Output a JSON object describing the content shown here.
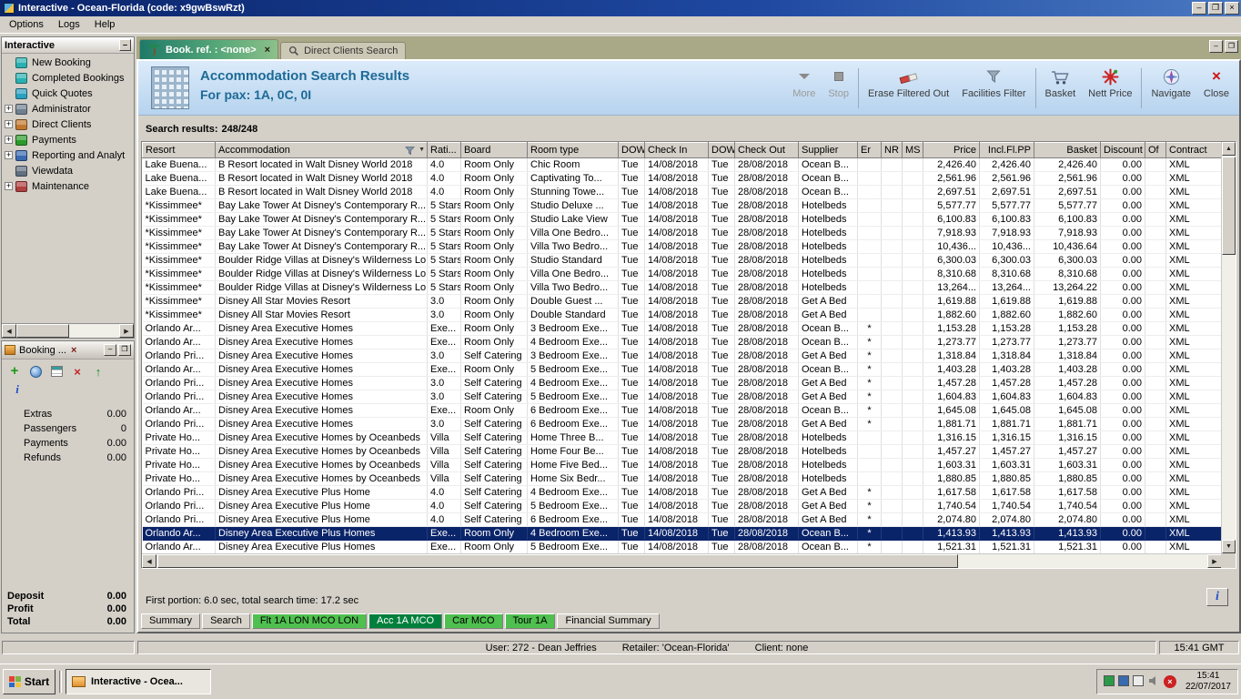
{
  "window": {
    "title": "Interactive - Ocean-Florida (code: x9gwBswRzt)",
    "menu": [
      "Options",
      "Logs",
      "Help"
    ]
  },
  "sidebar": {
    "title": "Interactive",
    "items": [
      {
        "label": "New Booking",
        "expandable": false,
        "icon": "new-booking-icon",
        "icon_color": "#2ab0b0"
      },
      {
        "label": "Completed Bookings",
        "expandable": false,
        "icon": "completed-bookings-icon",
        "icon_color": "#2ab0b0"
      },
      {
        "label": "Quick Quotes",
        "expandable": false,
        "icon": "quick-quotes-icon",
        "icon_color": "#2aa0c0"
      },
      {
        "label": "Administrator",
        "expandable": true,
        "icon": "administrator-icon",
        "icon_color": "#708090"
      },
      {
        "label": "Direct Clients",
        "expandable": true,
        "icon": "direct-clients-icon",
        "icon_color": "#c07830"
      },
      {
        "label": "Payments",
        "expandable": true,
        "icon": "payments-icon",
        "icon_color": "#2a9a2a"
      },
      {
        "label": "Reporting and Analyt",
        "expandable": true,
        "icon": "reporting-icon",
        "icon_color": "#3a6ab0"
      },
      {
        "label": "Viewdata",
        "expandable": false,
        "icon": "viewdata-icon",
        "icon_color": "#607080"
      },
      {
        "label": "Maintenance",
        "expandable": true,
        "icon": "maintenance-icon",
        "icon_color": "#b04040"
      }
    ]
  },
  "booking_panel": {
    "title": "Booking ...",
    "tools": [
      "add-icon",
      "world-icon",
      "quotes-icon",
      "delete-icon",
      "send-icon"
    ],
    "fields": [
      {
        "label": "Extras",
        "value": "0.00"
      },
      {
        "label": "Passengers",
        "value": "0"
      },
      {
        "label": "Payments",
        "value": "0.00"
      },
      {
        "label": "Refunds",
        "value": "0.00"
      }
    ],
    "totals": [
      {
        "label": "Deposit",
        "value": "0.00"
      },
      {
        "label": "Profit",
        "value": "0.00"
      },
      {
        "label": "Total",
        "value": "0.00"
      }
    ]
  },
  "tabs": [
    {
      "label": "Book. ref. : <none>",
      "icon": "palm-tree-icon",
      "active": true,
      "closable": true
    },
    {
      "label": "Direct Clients Search",
      "icon": "search-icon",
      "active": false,
      "closable": false
    }
  ],
  "header": {
    "title_line1": "Accommodation Search Results",
    "title_line2": "For pax: 1A, 0C, 0I",
    "accent_color": "#1d6a96",
    "buttons": [
      {
        "label": "More",
        "icon": "more-icon",
        "disabled": true,
        "sep_after": false
      },
      {
        "label": "Stop",
        "icon": "stop-icon",
        "disabled": true,
        "sep_after": true
      },
      {
        "label": "Erase Filtered Out",
        "icon": "erase-icon",
        "disabled": false,
        "sep_after": false
      },
      {
        "label": "Facilities Filter",
        "icon": "filter-icon",
        "disabled": false,
        "sep_after": true
      },
      {
        "label": "Basket",
        "icon": "basket-icon",
        "disabled": false,
        "sep_after": false
      },
      {
        "label": "Nett Price",
        "icon": "nett-price-icon",
        "disabled": false,
        "sep_after": true
      },
      {
        "label": "Navigate",
        "icon": "navigate-icon",
        "disabled": false,
        "sep_after": false
      },
      {
        "label": "Close",
        "icon": "close-icon",
        "disabled": false,
        "sep_after": false
      }
    ]
  },
  "results": {
    "label": "Search results:",
    "count": "248/248"
  },
  "table": {
    "selected_row": 27,
    "selected_color": "#0a246a",
    "columns": [
      "Resort",
      "Accommodation",
      "Rati...",
      "Board",
      "Room type",
      "DOW",
      "Check In",
      "DOW",
      "Check Out",
      "Supplier",
      "Er",
      "NR",
      "MS",
      "Price",
      "Incl.Fl.PP",
      "Basket",
      "Discount",
      "Of",
      "Contract"
    ],
    "rows": [
      [
        "Lake Buena...",
        "B Resort located in Walt Disney World 2018",
        "4.0",
        "Room Only",
        "Chic Room",
        "Tue",
        "14/08/2018",
        "Tue",
        "28/08/2018",
        "Ocean B...",
        "",
        "",
        "",
        "2,426.40",
        "2,426.40",
        "2,426.40",
        "0.00",
        "",
        "XML"
      ],
      [
        "Lake Buena...",
        "B Resort located in Walt Disney World 2018",
        "4.0",
        "Room Only",
        "Captivating To...",
        "Tue",
        "14/08/2018",
        "Tue",
        "28/08/2018",
        "Ocean B...",
        "",
        "",
        "",
        "2,561.96",
        "2,561.96",
        "2,561.96",
        "0.00",
        "",
        "XML"
      ],
      [
        "Lake Buena...",
        "B Resort located in Walt Disney World 2018",
        "4.0",
        "Room Only",
        "Stunning Towe...",
        "Tue",
        "14/08/2018",
        "Tue",
        "28/08/2018",
        "Ocean B...",
        "",
        "",
        "",
        "2,697.51",
        "2,697.51",
        "2,697.51",
        "0.00",
        "",
        "XML"
      ],
      [
        "*Kissimmee*",
        "Bay Lake Tower At Disney's Contemporary R...",
        "5 Stars",
        "Room Only",
        "Studio Deluxe ...",
        "Tue",
        "14/08/2018",
        "Tue",
        "28/08/2018",
        "Hotelbeds",
        "",
        "",
        "",
        "5,577.77",
        "5,577.77",
        "5,577.77",
        "0.00",
        "",
        "XML"
      ],
      [
        "*Kissimmee*",
        "Bay Lake Tower At Disney's Contemporary R...",
        "5 Stars",
        "Room Only",
        "Studio Lake View",
        "Tue",
        "14/08/2018",
        "Tue",
        "28/08/2018",
        "Hotelbeds",
        "",
        "",
        "",
        "6,100.83",
        "6,100.83",
        "6,100.83",
        "0.00",
        "",
        "XML"
      ],
      [
        "*Kissimmee*",
        "Bay Lake Tower At Disney's Contemporary R...",
        "5 Stars",
        "Room Only",
        "Villa One Bedro...",
        "Tue",
        "14/08/2018",
        "Tue",
        "28/08/2018",
        "Hotelbeds",
        "",
        "",
        "",
        "7,918.93",
        "7,918.93",
        "7,918.93",
        "0.00",
        "",
        "XML"
      ],
      [
        "*Kissimmee*",
        "Bay Lake Tower At Disney's Contemporary R...",
        "5 Stars",
        "Room Only",
        "Villa Two Bedro...",
        "Tue",
        "14/08/2018",
        "Tue",
        "28/08/2018",
        "Hotelbeds",
        "",
        "",
        "",
        "10,436...",
        "10,436...",
        "10,436.64",
        "0.00",
        "",
        "XML"
      ],
      [
        "*Kissimmee*",
        "Boulder Ridge Villas at Disney's Wilderness Lo...",
        "5 Stars",
        "Room Only",
        "Studio Standard",
        "Tue",
        "14/08/2018",
        "Tue",
        "28/08/2018",
        "Hotelbeds",
        "",
        "",
        "",
        "6,300.03",
        "6,300.03",
        "6,300.03",
        "0.00",
        "",
        "XML"
      ],
      [
        "*Kissimmee*",
        "Boulder Ridge Villas at Disney's Wilderness Lo...",
        "5 Stars",
        "Room Only",
        "Villa One Bedro...",
        "Tue",
        "14/08/2018",
        "Tue",
        "28/08/2018",
        "Hotelbeds",
        "",
        "",
        "",
        "8,310.68",
        "8,310.68",
        "8,310.68",
        "0.00",
        "",
        "XML"
      ],
      [
        "*Kissimmee*",
        "Boulder Ridge Villas at Disney's Wilderness Lo...",
        "5 Stars",
        "Room Only",
        "Villa Two Bedro...",
        "Tue",
        "14/08/2018",
        "Tue",
        "28/08/2018",
        "Hotelbeds",
        "",
        "",
        "",
        "13,264...",
        "13,264...",
        "13,264.22",
        "0.00",
        "",
        "XML"
      ],
      [
        "*Kissimmee*",
        "Disney All Star Movies Resort",
        "3.0",
        "Room Only",
        "Double Guest ...",
        "Tue",
        "14/08/2018",
        "Tue",
        "28/08/2018",
        "Get A Bed",
        "",
        "",
        "",
        "1,619.88",
        "1,619.88",
        "1,619.88",
        "0.00",
        "",
        "XML"
      ],
      [
        "*Kissimmee*",
        "Disney All Star Movies Resort",
        "3.0",
        "Room Only",
        "Double Standard",
        "Tue",
        "14/08/2018",
        "Tue",
        "28/08/2018",
        "Get A Bed",
        "",
        "",
        "",
        "1,882.60",
        "1,882.60",
        "1,882.60",
        "0.00",
        "",
        "XML"
      ],
      [
        "Orlando Ar...",
        "Disney Area Executive Homes",
        "Exe...",
        "Room Only",
        "3 Bedroom Exe...",
        "Tue",
        "14/08/2018",
        "Tue",
        "28/08/2018",
        "Ocean B...",
        "*",
        "",
        "",
        "1,153.28",
        "1,153.28",
        "1,153.28",
        "0.00",
        "",
        "XML"
      ],
      [
        "Orlando Ar...",
        "Disney Area Executive Homes",
        "Exe...",
        "Room Only",
        "4 Bedroom Exe...",
        "Tue",
        "14/08/2018",
        "Tue",
        "28/08/2018",
        "Ocean B...",
        "*",
        "",
        "",
        "1,273.77",
        "1,273.77",
        "1,273.77",
        "0.00",
        "",
        "XML"
      ],
      [
        "Orlando Pri...",
        "Disney Area Executive Homes",
        "3.0",
        "Self Catering",
        "3 Bedroom Exe...",
        "Tue",
        "14/08/2018",
        "Tue",
        "28/08/2018",
        "Get A Bed",
        "*",
        "",
        "",
        "1,318.84",
        "1,318.84",
        "1,318.84",
        "0.00",
        "",
        "XML"
      ],
      [
        "Orlando Ar...",
        "Disney Area Executive Homes",
        "Exe...",
        "Room Only",
        "5 Bedroom Exe...",
        "Tue",
        "14/08/2018",
        "Tue",
        "28/08/2018",
        "Ocean B...",
        "*",
        "",
        "",
        "1,403.28",
        "1,403.28",
        "1,403.28",
        "0.00",
        "",
        "XML"
      ],
      [
        "Orlando Pri...",
        "Disney Area Executive Homes",
        "3.0",
        "Self Catering",
        "4 Bedroom Exe...",
        "Tue",
        "14/08/2018",
        "Tue",
        "28/08/2018",
        "Get A Bed",
        "*",
        "",
        "",
        "1,457.28",
        "1,457.28",
        "1,457.28",
        "0.00",
        "",
        "XML"
      ],
      [
        "Orlando Pri...",
        "Disney Area Executive Homes",
        "3.0",
        "Self Catering",
        "5 Bedroom Exe...",
        "Tue",
        "14/08/2018",
        "Tue",
        "28/08/2018",
        "Get A Bed",
        "*",
        "",
        "",
        "1,604.83",
        "1,604.83",
        "1,604.83",
        "0.00",
        "",
        "XML"
      ],
      [
        "Orlando Ar...",
        "Disney Area Executive Homes",
        "Exe...",
        "Room Only",
        "6 Bedroom Exe...",
        "Tue",
        "14/08/2018",
        "Tue",
        "28/08/2018",
        "Ocean B...",
        "*",
        "",
        "",
        "1,645.08",
        "1,645.08",
        "1,645.08",
        "0.00",
        "",
        "XML"
      ],
      [
        "Orlando Pri...",
        "Disney Area Executive Homes",
        "3.0",
        "Self Catering",
        "6 Bedroom Exe...",
        "Tue",
        "14/08/2018",
        "Tue",
        "28/08/2018",
        "Get A Bed",
        "*",
        "",
        "",
        "1,881.71",
        "1,881.71",
        "1,881.71",
        "0.00",
        "",
        "XML"
      ],
      [
        "Private Ho...",
        "Disney Area Executive Homes by Oceanbeds",
        "Villa",
        "Self Catering",
        "Home Three B...",
        "Tue",
        "14/08/2018",
        "Tue",
        "28/08/2018",
        "Hotelbeds",
        "",
        "",
        "",
        "1,316.15",
        "1,316.15",
        "1,316.15",
        "0.00",
        "",
        "XML"
      ],
      [
        "Private Ho...",
        "Disney Area Executive Homes by Oceanbeds",
        "Villa",
        "Self Catering",
        "Home Four Be...",
        "Tue",
        "14/08/2018",
        "Tue",
        "28/08/2018",
        "Hotelbeds",
        "",
        "",
        "",
        "1,457.27",
        "1,457.27",
        "1,457.27",
        "0.00",
        "",
        "XML"
      ],
      [
        "Private Ho...",
        "Disney Area Executive Homes by Oceanbeds",
        "Villa",
        "Self Catering",
        "Home Five Bed...",
        "Tue",
        "14/08/2018",
        "Tue",
        "28/08/2018",
        "Hotelbeds",
        "",
        "",
        "",
        "1,603.31",
        "1,603.31",
        "1,603.31",
        "0.00",
        "",
        "XML"
      ],
      [
        "Private Ho...",
        "Disney Area Executive Homes by Oceanbeds",
        "Villa",
        "Self Catering",
        "Home Six Bedr...",
        "Tue",
        "14/08/2018",
        "Tue",
        "28/08/2018",
        "Hotelbeds",
        "",
        "",
        "",
        "1,880.85",
        "1,880.85",
        "1,880.85",
        "0.00",
        "",
        "XML"
      ],
      [
        "Orlando Pri...",
        "Disney Area Executive Plus Home",
        "4.0",
        "Self Catering",
        "4 Bedroom Exe...",
        "Tue",
        "14/08/2018",
        "Tue",
        "28/08/2018",
        "Get A Bed",
        "*",
        "",
        "",
        "1,617.58",
        "1,617.58",
        "1,617.58",
        "0.00",
        "",
        "XML"
      ],
      [
        "Orlando Pri...",
        "Disney Area Executive Plus Home",
        "4.0",
        "Self Catering",
        "5 Bedroom Exe...",
        "Tue",
        "14/08/2018",
        "Tue",
        "28/08/2018",
        "Get A Bed",
        "*",
        "",
        "",
        "1,740.54",
        "1,740.54",
        "1,740.54",
        "0.00",
        "",
        "XML"
      ],
      [
        "Orlando Pri...",
        "Disney Area Executive Plus Home",
        "4.0",
        "Self Catering",
        "6 Bedroom Exe...",
        "Tue",
        "14/08/2018",
        "Tue",
        "28/08/2018",
        "Get A Bed",
        "*",
        "",
        "",
        "2,074.80",
        "2,074.80",
        "2,074.80",
        "0.00",
        "",
        "XML"
      ],
      [
        "Orlando Ar...",
        "Disney Area Executive Plus Homes",
        "Exe...",
        "Room Only",
        "4 Bedroom Exe...",
        "Tue",
        "14/08/2018",
        "Tue",
        "28/08/2018",
        "Ocean B...",
        "*",
        "",
        "",
        "1,413.93",
        "1,413.93",
        "1,413.93",
        "0.00",
        "",
        "XML"
      ],
      [
        "Orlando Ar...",
        "Disney Area Executive Plus Homes",
        "Exe...",
        "Room Only",
        "5 Bedroom Exe...",
        "Tue",
        "14/08/2018",
        "Tue",
        "28/08/2018",
        "Ocean B...",
        "*",
        "",
        "",
        "1,521.31",
        "1,521.31",
        "1,521.31",
        "0.00",
        "",
        "XML"
      ]
    ]
  },
  "status_line": "First portion: 6.0 sec, total search time: 17.2 sec",
  "bottom_tabs": [
    {
      "label": "Summary",
      "type": "normal"
    },
    {
      "label": "Search",
      "type": "normal"
    },
    {
      "label": "Flt 1A LON MCO LON",
      "type": "green"
    },
    {
      "label": "Acc 1A MCO",
      "type": "green-active"
    },
    {
      "label": "Car MCO",
      "type": "green"
    },
    {
      "label": "Tour 1A",
      "type": "green"
    },
    {
      "label": "Financial Summary",
      "type": "normal"
    }
  ],
  "statusbar": {
    "user": "User: 272 - Dean Jeffries",
    "retailer": "Retailer: 'Ocean-Florida'",
    "client": "Client: none",
    "time": "15:41 GMT"
  },
  "taskbar": {
    "start_label": "Start",
    "task_label": "Interactive - Ocea...",
    "tray_icons": [
      "network-icon",
      "display-icon",
      "document-icon",
      "volume-icon",
      "error-icon"
    ],
    "time": "15:41",
    "date": "22/07/2017"
  }
}
